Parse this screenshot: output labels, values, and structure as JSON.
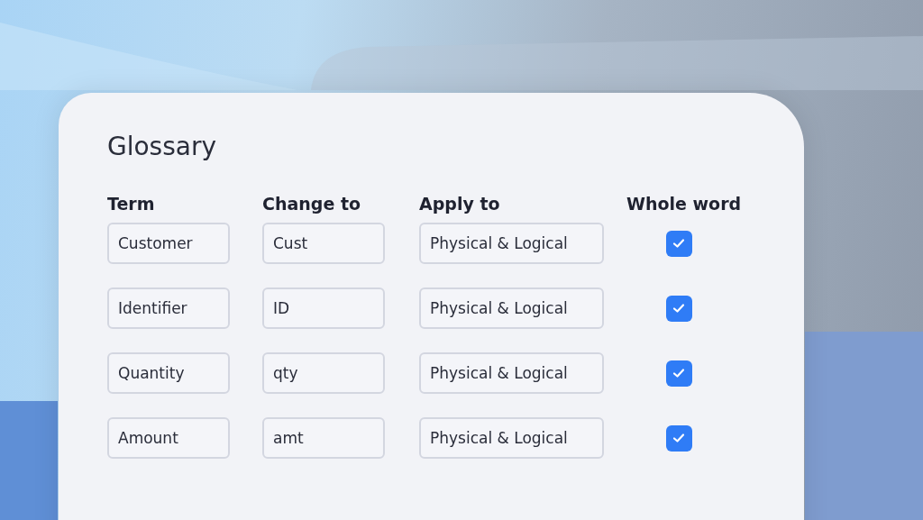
{
  "title": "Glossary",
  "columns": [
    "Term",
    "Change to",
    "Apply to",
    "Whole word"
  ],
  "rows": [
    {
      "term": "Customer",
      "change_to": "Cust",
      "apply_to": "Physical & Logical",
      "whole_word": true
    },
    {
      "term": "Identifier",
      "change_to": "ID",
      "apply_to": "Physical & Logical",
      "whole_word": true
    },
    {
      "term": "Quantity",
      "change_to": "qty",
      "apply_to": "Physical & Logical",
      "whole_word": true
    },
    {
      "term": "Amount",
      "change_to": "amt",
      "apply_to": "Physical & Logical",
      "whole_word": true
    }
  ]
}
